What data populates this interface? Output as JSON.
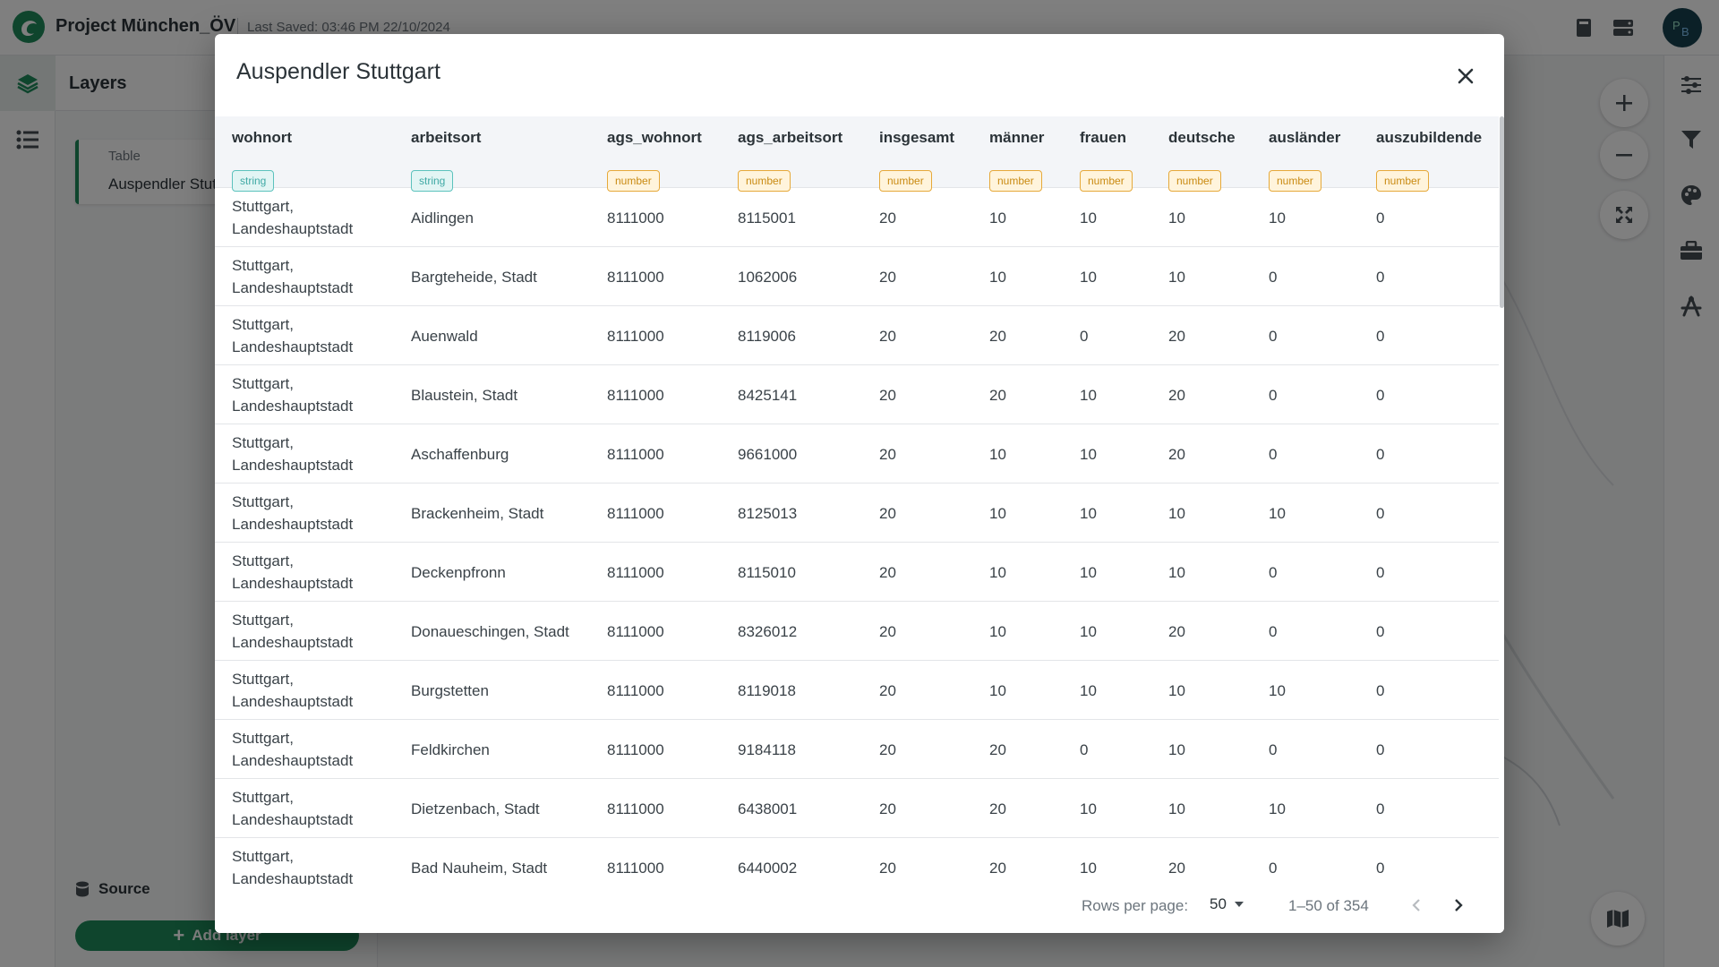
{
  "app": {
    "project_name": "Project München_ÖV",
    "last_saved": "Last Saved: 03:46 PM 22/10/2024",
    "avatar_initials": "PB",
    "brand_color": "#1f8a5b"
  },
  "layers_panel": {
    "title": "Layers",
    "layer_type": "Table",
    "layer_name": "Auspendler Stuttgart",
    "source_label": "Source",
    "add_layer_label": "Add layer"
  },
  "modal": {
    "title": "Auspendler Stuttgart",
    "columns": [
      {
        "name": "wohnort",
        "type": "string"
      },
      {
        "name": "arbeitsort",
        "type": "string"
      },
      {
        "name": "ags_wohnort",
        "type": "number"
      },
      {
        "name": "ags_arbeitsort",
        "type": "number"
      },
      {
        "name": "insgesamt",
        "type": "number"
      },
      {
        "name": "männer",
        "type": "number"
      },
      {
        "name": "frauen",
        "type": "number"
      },
      {
        "name": "deutsche",
        "type": "number"
      },
      {
        "name": "ausländer",
        "type": "number"
      },
      {
        "name": "auszubildende",
        "type": "number"
      }
    ],
    "rows": [
      [
        "Stuttgart, Landeshauptstadt",
        "Aidlingen",
        "8111000",
        "8115001",
        "20",
        "10",
        "10",
        "10",
        "10",
        "0"
      ],
      [
        "Stuttgart, Landeshauptstadt",
        "Bargteheide, Stadt",
        "8111000",
        "1062006",
        "20",
        "10",
        "10",
        "10",
        "0",
        "0"
      ],
      [
        "Stuttgart, Landeshauptstadt",
        "Auenwald",
        "8111000",
        "8119006",
        "20",
        "20",
        "0",
        "20",
        "0",
        "0"
      ],
      [
        "Stuttgart, Landeshauptstadt",
        "Blaustein, Stadt",
        "8111000",
        "8425141",
        "20",
        "20",
        "10",
        "20",
        "0",
        "0"
      ],
      [
        "Stuttgart, Landeshauptstadt",
        "Aschaffenburg",
        "8111000",
        "9661000",
        "20",
        "10",
        "10",
        "20",
        "0",
        "0"
      ],
      [
        "Stuttgart, Landeshauptstadt",
        "Brackenheim, Stadt",
        "8111000",
        "8125013",
        "20",
        "10",
        "10",
        "10",
        "10",
        "0"
      ],
      [
        "Stuttgart, Landeshauptstadt",
        "Deckenpfronn",
        "8111000",
        "8115010",
        "20",
        "10",
        "10",
        "10",
        "0",
        "0"
      ],
      [
        "Stuttgart, Landeshauptstadt",
        "Donaueschingen, Stadt",
        "8111000",
        "8326012",
        "20",
        "10",
        "10",
        "20",
        "0",
        "0"
      ],
      [
        "Stuttgart, Landeshauptstadt",
        "Burgstetten",
        "8111000",
        "8119018",
        "20",
        "10",
        "10",
        "10",
        "10",
        "0"
      ],
      [
        "Stuttgart, Landeshauptstadt",
        "Feldkirchen",
        "8111000",
        "9184118",
        "20",
        "20",
        "0",
        "10",
        "0",
        "0"
      ],
      [
        "Stuttgart, Landeshauptstadt",
        "Dietzenbach, Stadt",
        "8111000",
        "6438001",
        "20",
        "20",
        "10",
        "10",
        "10",
        "0"
      ],
      [
        "Stuttgart, Landeshauptstadt",
        "Bad Nauheim, Stadt",
        "8111000",
        "6440002",
        "20",
        "20",
        "10",
        "20",
        "0",
        "0"
      ]
    ],
    "pagination": {
      "rows_per_page_label": "Rows per page:",
      "rows_per_page_value": "50",
      "range": "1–50 of 354"
    }
  }
}
